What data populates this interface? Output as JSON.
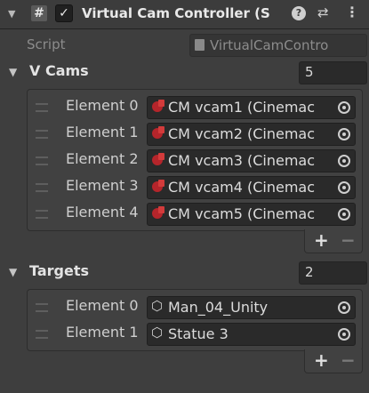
{
  "component": {
    "title": "Virtual Cam Controller (S",
    "enabled_mark": "✓",
    "hash_glyph": "#",
    "fold_glyph": "▼",
    "help_glyph": "?",
    "preset_glyph": "⇄",
    "menu_glyph": "⋮"
  },
  "script": {
    "label": "Script",
    "value": "VirtualCamContro"
  },
  "vcams": {
    "fold_glyph": "▼",
    "label": "V Cams",
    "size": "5",
    "elements": [
      {
        "label": "Element 0",
        "value": "CM vcam1 (Cinemac"
      },
      {
        "label": "Element 1",
        "value": "CM vcam2 (Cinemac"
      },
      {
        "label": "Element 2",
        "value": "CM vcam3 (Cinemac"
      },
      {
        "label": "Element 3",
        "value": "CM vcam4 (Cinemac"
      },
      {
        "label": "Element 4",
        "value": "CM vcam5 (Cinemac"
      }
    ],
    "add_glyph": "+",
    "remove_glyph": "−"
  },
  "targets": {
    "fold_glyph": "▼",
    "label": "Targets",
    "size": "2",
    "elements": [
      {
        "label": "Element 0",
        "value": "Man_04_Unity"
      },
      {
        "label": "Element 1",
        "value": "Statue 3"
      }
    ],
    "object_glyph": "⬡",
    "add_glyph": "+",
    "remove_glyph": "−"
  },
  "icons": {
    "component": "script-component-icon",
    "camera": "cinemachine-camera-icon",
    "gameobject": "gameobject-cube-icon",
    "picker": "object-picker-icon"
  },
  "colors": {
    "background": "#3e3e3e",
    "field": "#2a2a2a",
    "camera_icon": "#b5252b"
  }
}
